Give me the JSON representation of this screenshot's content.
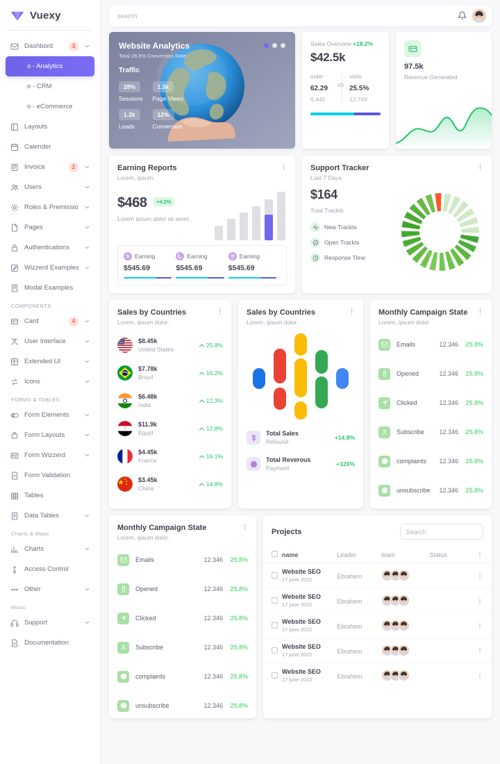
{
  "brand": {
    "name": "Vuexy",
    "logo_icon": "heart-logo"
  },
  "topbar": {
    "search_placeholder": "search",
    "bell_icon": "bell-icon",
    "avatar_icon": "user-avatar"
  },
  "sidebar": {
    "items": [
      {
        "label": "Dashbord",
        "icon": "mail-icon",
        "badge": "3",
        "chevron": true,
        "type": "item"
      },
      {
        "label": "o - Analytics",
        "icon": "dot",
        "active": true,
        "type": "sub"
      },
      {
        "label": "o - CRM",
        "icon": "dot",
        "type": "sub"
      },
      {
        "label": "o - eCommerce",
        "icon": "dot",
        "type": "sub"
      },
      {
        "label": "Layouts",
        "icon": "layout-icon",
        "type": "item"
      },
      {
        "label": "Calender",
        "icon": "calendar-icon",
        "type": "item"
      },
      {
        "label": "Invoice",
        "icon": "book-icon",
        "badge": "2",
        "chevron": true,
        "type": "item"
      },
      {
        "label": "Users",
        "icon": "users-icon",
        "chevron": true,
        "type": "item"
      },
      {
        "label": "Roles & Premissions",
        "icon": "gear-icon",
        "chevron": true,
        "type": "item"
      },
      {
        "label": "Pages",
        "icon": "file-icon",
        "chevron": true,
        "type": "item"
      },
      {
        "label": "Authentications",
        "icon": "lock-icon",
        "chevron": true,
        "type": "item"
      },
      {
        "label": "Wizzerd Examples",
        "icon": "edit-icon",
        "chevron": true,
        "type": "item"
      },
      {
        "label": "Modal Examples",
        "icon": "window-icon",
        "type": "item"
      },
      {
        "label": "COMPONENTS",
        "type": "section"
      },
      {
        "label": "Card",
        "icon": "card-icon",
        "badge": "4",
        "chevron": true,
        "type": "item"
      },
      {
        "label": "User Interface",
        "icon": "ui-icon",
        "chevron": true,
        "type": "item"
      },
      {
        "label": "Extended UI",
        "icon": "grid-icon",
        "chevron": true,
        "type": "item"
      },
      {
        "label": "Icons",
        "icon": "swap-icon",
        "chevron": true,
        "type": "item"
      },
      {
        "label": "FORMS & TABLES",
        "type": "section"
      },
      {
        "label": "Form Elements",
        "icon": "toggle-icon",
        "chevron": true,
        "type": "item"
      },
      {
        "label": "Form Layouts",
        "icon": "bag-icon",
        "chevron": true,
        "type": "item"
      },
      {
        "label": "Form Wizzerd",
        "icon": "form-icon",
        "chevron": true,
        "type": "item"
      },
      {
        "label": "Form Validation",
        "icon": "check-file-icon",
        "type": "item"
      },
      {
        "label": "Tables",
        "icon": "table-icon",
        "type": "item"
      },
      {
        "label": "Data Tables",
        "icon": "database-icon",
        "chevron": true,
        "type": "item"
      },
      {
        "label": "Charts & Maps",
        "type": "section-mixed"
      },
      {
        "label": "Charts",
        "icon": "chart-icon",
        "chevron": true,
        "type": "item"
      },
      {
        "label": "Access Control",
        "icon": "key-icon",
        "type": "item"
      },
      {
        "label": "Other",
        "icon": "dots-icon",
        "chevron": true,
        "type": "item"
      },
      {
        "label": "Music",
        "type": "section-mixed"
      },
      {
        "label": "Support",
        "icon": "headphone-icon",
        "chevron": true,
        "type": "item"
      },
      {
        "label": "Documentation",
        "icon": "doc-icon",
        "type": "item"
      }
    ]
  },
  "analytics": {
    "title": "Website Analytics",
    "subtitle": "Total 28.5% Conversion Rate",
    "traffic_label": "Traffic",
    "stats": [
      {
        "value": "28%",
        "label": "Sessions"
      },
      {
        "value": "1.3k",
        "label": "Page Views"
      },
      {
        "value": "1.2k",
        "label": "Leads"
      },
      {
        "value": "12%",
        "label": "Conversion"
      }
    ]
  },
  "sales_overview": {
    "title": "Sales Overview",
    "change": "+18.2%",
    "amount": "$42.5k",
    "left": {
      "label": "order",
      "value": "62.29",
      "vs": "VS",
      "sub": "6,440"
    },
    "right": {
      "label": "visits",
      "value": "25.5%",
      "sub": "12,749"
    },
    "bar_colors": [
      "#00cfe8",
      "#5b57e0"
    ]
  },
  "revenue": {
    "icon": "card-icon",
    "value": "97.5k",
    "label": "Revenue Generated",
    "color": "#28c76f"
  },
  "earning": {
    "title": "Earning Reports",
    "subtitle": "Lorem, ipsum.",
    "amount": "$468",
    "badge": "+4.2%",
    "caption": "Lorem ipsum dolor sit amet.",
    "bars": [
      28,
      42,
      54,
      66,
      80,
      95
    ],
    "highlight_index": 4,
    "highlight_color": "#7367f0",
    "bar_color": "#dfdee3",
    "cells": [
      {
        "icon": "dollar-icon",
        "label": "Earning",
        "value": "$545.69"
      },
      {
        "icon": "moon-icon",
        "label": "Earning",
        "value": "$545.69"
      },
      {
        "icon": "pin-icon",
        "label": "Earning",
        "value": "$545.69"
      }
    ],
    "progress_colors": [
      "#00cfe8",
      "#5b57e0"
    ]
  },
  "support": {
    "title": "Support Tracker",
    "subtitle": "Last 7 Days",
    "amount": "$164",
    "total_label": "Total Trackts",
    "items": [
      {
        "icon": "activity-icon",
        "label": "New Trackts"
      },
      {
        "icon": "check-circle-icon",
        "label": "Open Trackts"
      },
      {
        "icon": "clock-icon",
        "label": "Response Time"
      }
    ],
    "gauge": {
      "segments": 24,
      "accent_color": "#ff5722",
      "filled_color": "#5cbf3e",
      "empty_color": "#cfe9c6"
    }
  },
  "countries": {
    "title": "Sales by Countries",
    "subtitle": "Lorem, ipsum dolor.",
    "rows": [
      {
        "amount": "$8.45k",
        "name": "United States",
        "pct": "25.8%",
        "flag": "us-flag"
      },
      {
        "amount": "$7.78k",
        "name": "Brazil",
        "pct": "16.2%",
        "flag": "br-flag"
      },
      {
        "amount": "$6.48k",
        "name": "India",
        "pct": "12.3%",
        "flag": "in-flag"
      },
      {
        "amount": "$11.9k",
        "name": "Egypt",
        "pct": "12.8%",
        "flag": "eg-flag"
      },
      {
        "amount": "$4.45k",
        "name": "France",
        "pct": "16.1%",
        "flag": "fr-flag"
      },
      {
        "amount": "$3.45k",
        "name": "China",
        "pct": "14.8%",
        "flag": "cn-flag"
      }
    ]
  },
  "capsules": {
    "title": "Sales by Countries",
    "subtitle": "Lorem, ipsum dolor.",
    "rows": [
      {
        "icon": "dollar-icon",
        "title": "Total Sales",
        "sub": "Refound",
        "pct": "+14.8%"
      },
      {
        "icon": "atom-icon",
        "title": "Total Reverous",
        "sub": "Payment",
        "pct": "+126%"
      }
    ],
    "chart_colors": [
      "#1a73e8",
      "#ea4335",
      "#fbbc04",
      "#34a853",
      "#4285f4"
    ]
  },
  "campaign": {
    "title": "Monthly Campaign State",
    "subtitle": "Lorem, ipsum dolor.",
    "rows": [
      {
        "icon": "mail-icon",
        "label": "Emails",
        "value": "12.346",
        "pct": "25.8%"
      },
      {
        "icon": "open-icon",
        "label": "Opened",
        "value": "12.346",
        "pct": "25.8%"
      },
      {
        "icon": "click-icon",
        "label": "Clicked",
        "value": "12.346",
        "pct": "25.8%"
      },
      {
        "icon": "user-icon",
        "label": "Subscribe",
        "value": "12.346",
        "pct": "25.8%"
      },
      {
        "icon": "alert-icon",
        "label": "complaints",
        "value": "12.346",
        "pct": "25.8%"
      },
      {
        "icon": "alert-icon",
        "label": "unsubscribe",
        "value": "12.346",
        "pct": "25.8%"
      }
    ]
  },
  "campaign2": {
    "title": "Monthly Campaign State",
    "subtitle": "Lorem, ipsum dolor.",
    "rows": [
      {
        "icon": "mail-icon",
        "label": "Emails",
        "value": "12.346",
        "pct": "25.8%"
      },
      {
        "icon": "open-icon",
        "label": "Opened",
        "value": "12.346",
        "pct": "25.8%"
      },
      {
        "icon": "click-icon",
        "label": "Clicked",
        "value": "12.346",
        "pct": "25.8%"
      },
      {
        "icon": "user-icon",
        "label": "Subscribe",
        "value": "12.346",
        "pct": "25.8%"
      },
      {
        "icon": "alert-icon",
        "label": "complaints",
        "value": "12.346",
        "pct": "25.8%"
      },
      {
        "icon": "alert-icon",
        "label": "unsubscribe",
        "value": "12.346",
        "pct": "25.8%"
      }
    ]
  },
  "projects": {
    "title": "Projects",
    "search_placeholder": "Search",
    "columns": [
      "name",
      "Leader",
      "team",
      "Status"
    ],
    "rows": [
      {
        "name": "Website SEO",
        "date": "17 june 2022",
        "leader": "Ebrahem",
        "team_count": 3
      },
      {
        "name": "Website SEO",
        "date": "17 june 2022",
        "leader": "Ebrahem",
        "team_count": 3
      },
      {
        "name": "Website SEO",
        "date": "17 june 2022",
        "leader": "Ebrahem",
        "team_count": 3
      },
      {
        "name": "Website SEO",
        "date": "17 june 2022",
        "leader": "Ebrahem",
        "team_count": 3
      },
      {
        "name": "Website SEO",
        "date": "17 june 2022",
        "leader": "Ebrahem",
        "team_count": 3
      }
    ]
  }
}
